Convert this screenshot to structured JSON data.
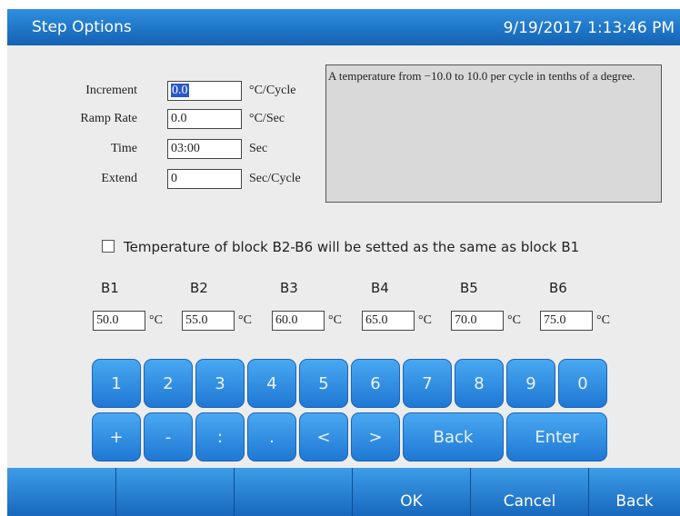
{
  "title": "Step Options",
  "datetime": "9/19/2017 1:13:46 PM",
  "fields": [
    {
      "label": "Increment",
      "value": "0.0",
      "unit": "°C/Cycle"
    },
    {
      "label": "Ramp Rate",
      "value": "0.0",
      "unit": "°C/Sec"
    },
    {
      "label": "Time",
      "value": "03:00",
      "unit": "Sec"
    },
    {
      "label": "Extend",
      "value": "0",
      "unit": "Sec/Cycle"
    }
  ],
  "help_text": "A temperature from −10.0 to 10.0 per cycle in tenths of a degree.",
  "same_as_b1_checked": false,
  "same_as_b1_label": "Temperature of block B2-B6 will be setted as the same as block B1",
  "blocks": [
    {
      "name": "B1",
      "value": "50.0",
      "unit": "°C"
    },
    {
      "name": "B2",
      "value": "55.0",
      "unit": "°C"
    },
    {
      "name": "B3",
      "value": "60.0",
      "unit": "°C"
    },
    {
      "name": "B4",
      "value": "65.0",
      "unit": "°C"
    },
    {
      "name": "B5",
      "value": "70.0",
      "unit": "°C"
    },
    {
      "name": "B6",
      "value": "75.0",
      "unit": "°C"
    }
  ],
  "keypad": {
    "row1": [
      "1",
      "2",
      "3",
      "4",
      "5",
      "6",
      "7",
      "8",
      "9",
      "0"
    ],
    "row2": [
      "+",
      "-",
      ":",
      ".",
      "<",
      ">"
    ],
    "back": "Back",
    "enter": "Enter"
  },
  "bottom": {
    "ok": "OK",
    "cancel": "Cancel",
    "back": "Back"
  },
  "colors": {
    "accent": "#1f78d4",
    "title_bar": "#1462b3",
    "background": "#ececec"
  }
}
